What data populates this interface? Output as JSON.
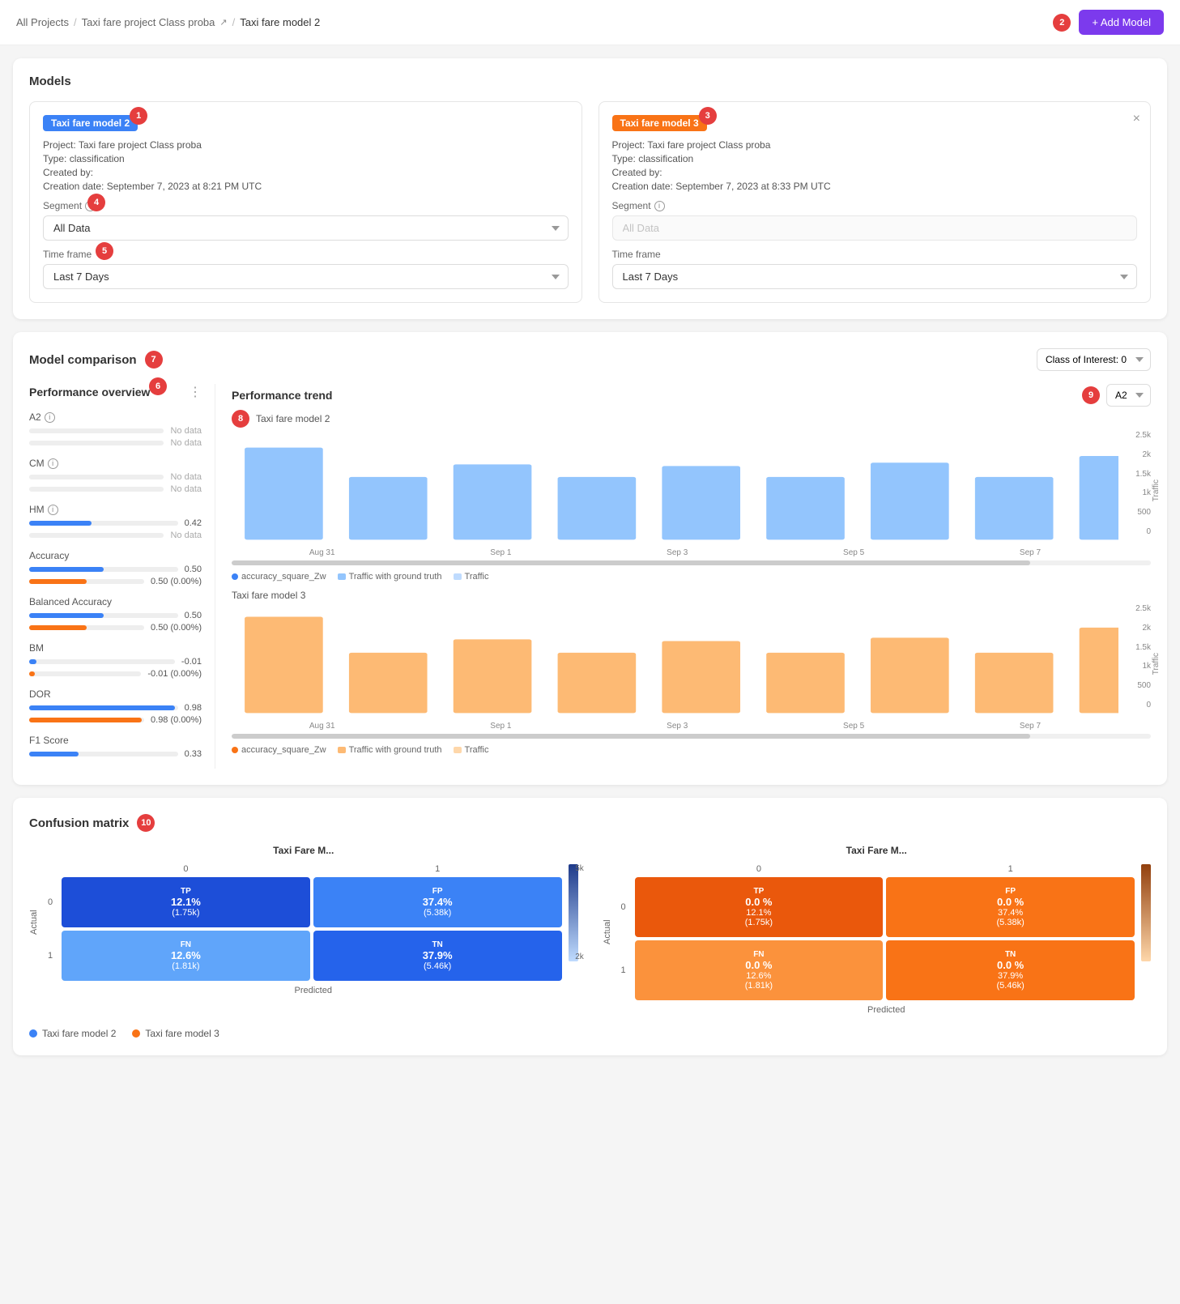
{
  "breadcrumb": {
    "all_projects": "All Projects",
    "project": "Taxi fare project Class proba",
    "current": "Taxi fare model 2",
    "sep1": "/",
    "sep2": "/"
  },
  "add_model_btn": "+ Add Model",
  "models_section": {
    "title": "Models",
    "model1": {
      "tag": "Taxi fare model 2",
      "project_label": "Project:",
      "project_val": "Taxi fare project Class proba",
      "type_label": "Type:",
      "type_val": "classification",
      "created_label": "Created by:",
      "created_val": "",
      "date_label": "Creation date:",
      "date_val": "September 7, 2023 at 8:21 PM UTC",
      "segment_label": "Segment",
      "segment_val": "All Data",
      "timeframe_label": "Time frame",
      "timeframe_val": "Last 7 Days"
    },
    "model2": {
      "tag": "Taxi fare model 3",
      "project_label": "Project:",
      "project_val": "Taxi fare project Class proba",
      "type_label": "Type:",
      "type_val": "classification",
      "created_label": "Created by:",
      "created_val": "",
      "date_label": "Creation date:",
      "date_val": "September 7, 2023 at 8:33 PM UTC",
      "segment_label": "Segment",
      "segment_val": "All Data",
      "timeframe_label": "Time frame",
      "timeframe_val": "Last 7 Days"
    }
  },
  "comparison_section": {
    "title": "Model comparison",
    "class_of_interest_label": "Class of Interest: 0",
    "metric_selector": "A2",
    "perf_overview": {
      "title": "Performance overview",
      "metrics": [
        {
          "name": "A2",
          "has_info": true,
          "blue_val": null,
          "orange_val": null,
          "blue_text": "No data",
          "orange_text": "No data",
          "blue_pct": 0,
          "orange_pct": 0
        },
        {
          "name": "CM",
          "has_info": true,
          "blue_val": null,
          "orange_val": null,
          "blue_text": "No data",
          "orange_text": "No data",
          "blue_pct": 0,
          "orange_pct": 0
        },
        {
          "name": "HM",
          "has_info": true,
          "blue_val": "0.42",
          "orange_val": null,
          "blue_text": "0.42",
          "orange_text": "No data",
          "blue_pct": 42,
          "orange_pct": 0
        },
        {
          "name": "Accuracy",
          "has_info": false,
          "blue_val": "0.50",
          "orange_val": "0.50 (0.00%)",
          "blue_text": "0.50",
          "orange_text": "0.50 (0.00%)",
          "blue_pct": 50,
          "orange_pct": 50
        },
        {
          "name": "Balanced Accuracy",
          "has_info": false,
          "blue_val": "0.50",
          "orange_val": "0.50 (0.00%)",
          "blue_text": "0.50",
          "orange_text": "0.50 (0.00%)",
          "blue_pct": 50,
          "orange_pct": 50
        },
        {
          "name": "BM",
          "has_info": false,
          "blue_val": "-0.01",
          "orange_val": "-0.01 (0.00%)",
          "blue_text": "-0.01",
          "orange_text": "-0.01 (0.00%)",
          "blue_pct": 1,
          "orange_pct": 1
        },
        {
          "name": "DOR",
          "has_info": false,
          "blue_val": "0.98",
          "orange_val": "0.98 (0.00%)",
          "blue_text": "0.98",
          "orange_text": "0.98 (0.00%)",
          "blue_pct": 98,
          "orange_pct": 98
        },
        {
          "name": "F1 Score",
          "has_info": false,
          "blue_val": "0.33",
          "orange_val": null,
          "blue_text": "0.33",
          "orange_text": "",
          "blue_pct": 33,
          "orange_pct": 0
        }
      ]
    },
    "trend": {
      "title": "Performance trend",
      "model2_name": "Taxi fare model 2",
      "model3_name": "Taxi fare model 3",
      "x_labels": [
        "Aug 31",
        "Sep 1",
        "Sep 3",
        "Sep 5",
        "Sep 7"
      ],
      "model2_bars": [
        85,
        50,
        70,
        50,
        65,
        50,
        75,
        50,
        80
      ],
      "model3_bars": [
        90,
        45,
        65,
        45,
        60,
        45,
        70,
        45,
        75
      ],
      "y_labels": [
        "2.5k",
        "2k",
        "1.5k",
        "1k",
        "500",
        "0"
      ],
      "legend_blue": {
        "dot": "accuracy_square_Zw",
        "rect1": "Traffic with ground truth",
        "rect2": "Traffic"
      }
    }
  },
  "confusion_matrix": {
    "title": "Confusion matrix",
    "model2_title": "Taxi Fare M...",
    "model3_title": "Taxi Fare M...",
    "top_labels": [
      "0",
      "1"
    ],
    "left_labels": [
      "0",
      "1"
    ],
    "model2_cells": {
      "tp_label": "TP",
      "tp_pct": "12.1%",
      "tp_count": "(1.75k)",
      "fp_label": "FP",
      "fp_pct": "37.4%",
      "fp_count": "(5.38k)",
      "fn_label": "FN",
      "fn_pct": "12.6%",
      "fn_count": "(1.81k)",
      "tn_label": "TN",
      "tn_pct": "37.9%",
      "tn_count": "(5.46k)"
    },
    "model3_cells": {
      "tp_label": "TP",
      "tp_pct": "0.0 %",
      "tp_count": "",
      "fp_label": "FP",
      "fp_pct": "0.0 %",
      "fp_count": "",
      "fn_label": "FN",
      "fn_pct": "0.0 %",
      "fn_count": "",
      "tn_label": "TN",
      "tn_pct": "0.0 %",
      "tn_count": ""
    },
    "model2_cells2": {
      "tp_pct": "12.1%",
      "tp_count": "(1.75k)",
      "fp_pct": "37.4%",
      "fp_count": "(5.38k)",
      "fn_pct": "12.6%",
      "fn_count": "(1.81k)",
      "tn_pct": "37.9%",
      "tn_count": "(5.46k)"
    },
    "colorbar_max": "5k",
    "colorbar_min": "2k",
    "x_axis": "Predicted",
    "y_axis": "Actual",
    "legend": {
      "item1": "Taxi fare model 2",
      "item2": "Taxi fare model 3"
    }
  },
  "badges": {
    "b1": "1",
    "b2": "2",
    "b3": "3",
    "b4": "4",
    "b5": "5",
    "b6": "6",
    "b7": "7",
    "b8": "8",
    "b9": "9",
    "b10": "10"
  }
}
